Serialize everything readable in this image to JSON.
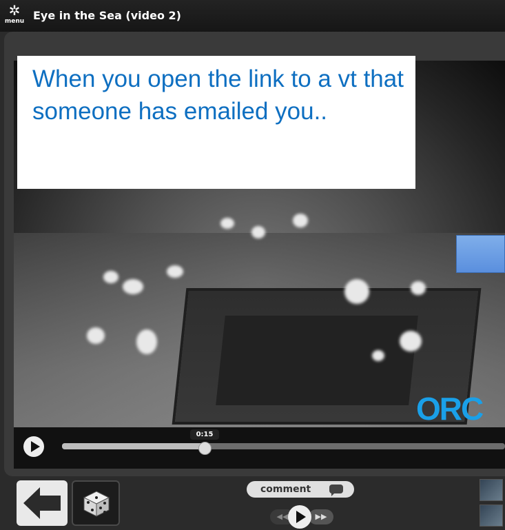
{
  "header": {
    "menu_icon": "gear-icon",
    "menu_label": "menu",
    "title": "Eye in the Sea (video 2)"
  },
  "callout": {
    "text": "When you open the link to a vt that someone has emailed you.."
  },
  "player": {
    "timestamp": "0:15",
    "progress_fraction": 0.32,
    "logo_text": "ORC"
  },
  "toolbar": {
    "back_icon": "back-arrow-icon",
    "dice_icon": "dice-icon",
    "comment_label": "comment",
    "comment_icon": "speech-bubble-icon",
    "rewind_icon": "rewind-icon",
    "play_icon": "play-icon",
    "forward_icon": "fast-forward-icon"
  },
  "colors": {
    "callout_text": "#0e6fc1",
    "logo": "#1aa0e8",
    "background": "#2b2b2b"
  }
}
